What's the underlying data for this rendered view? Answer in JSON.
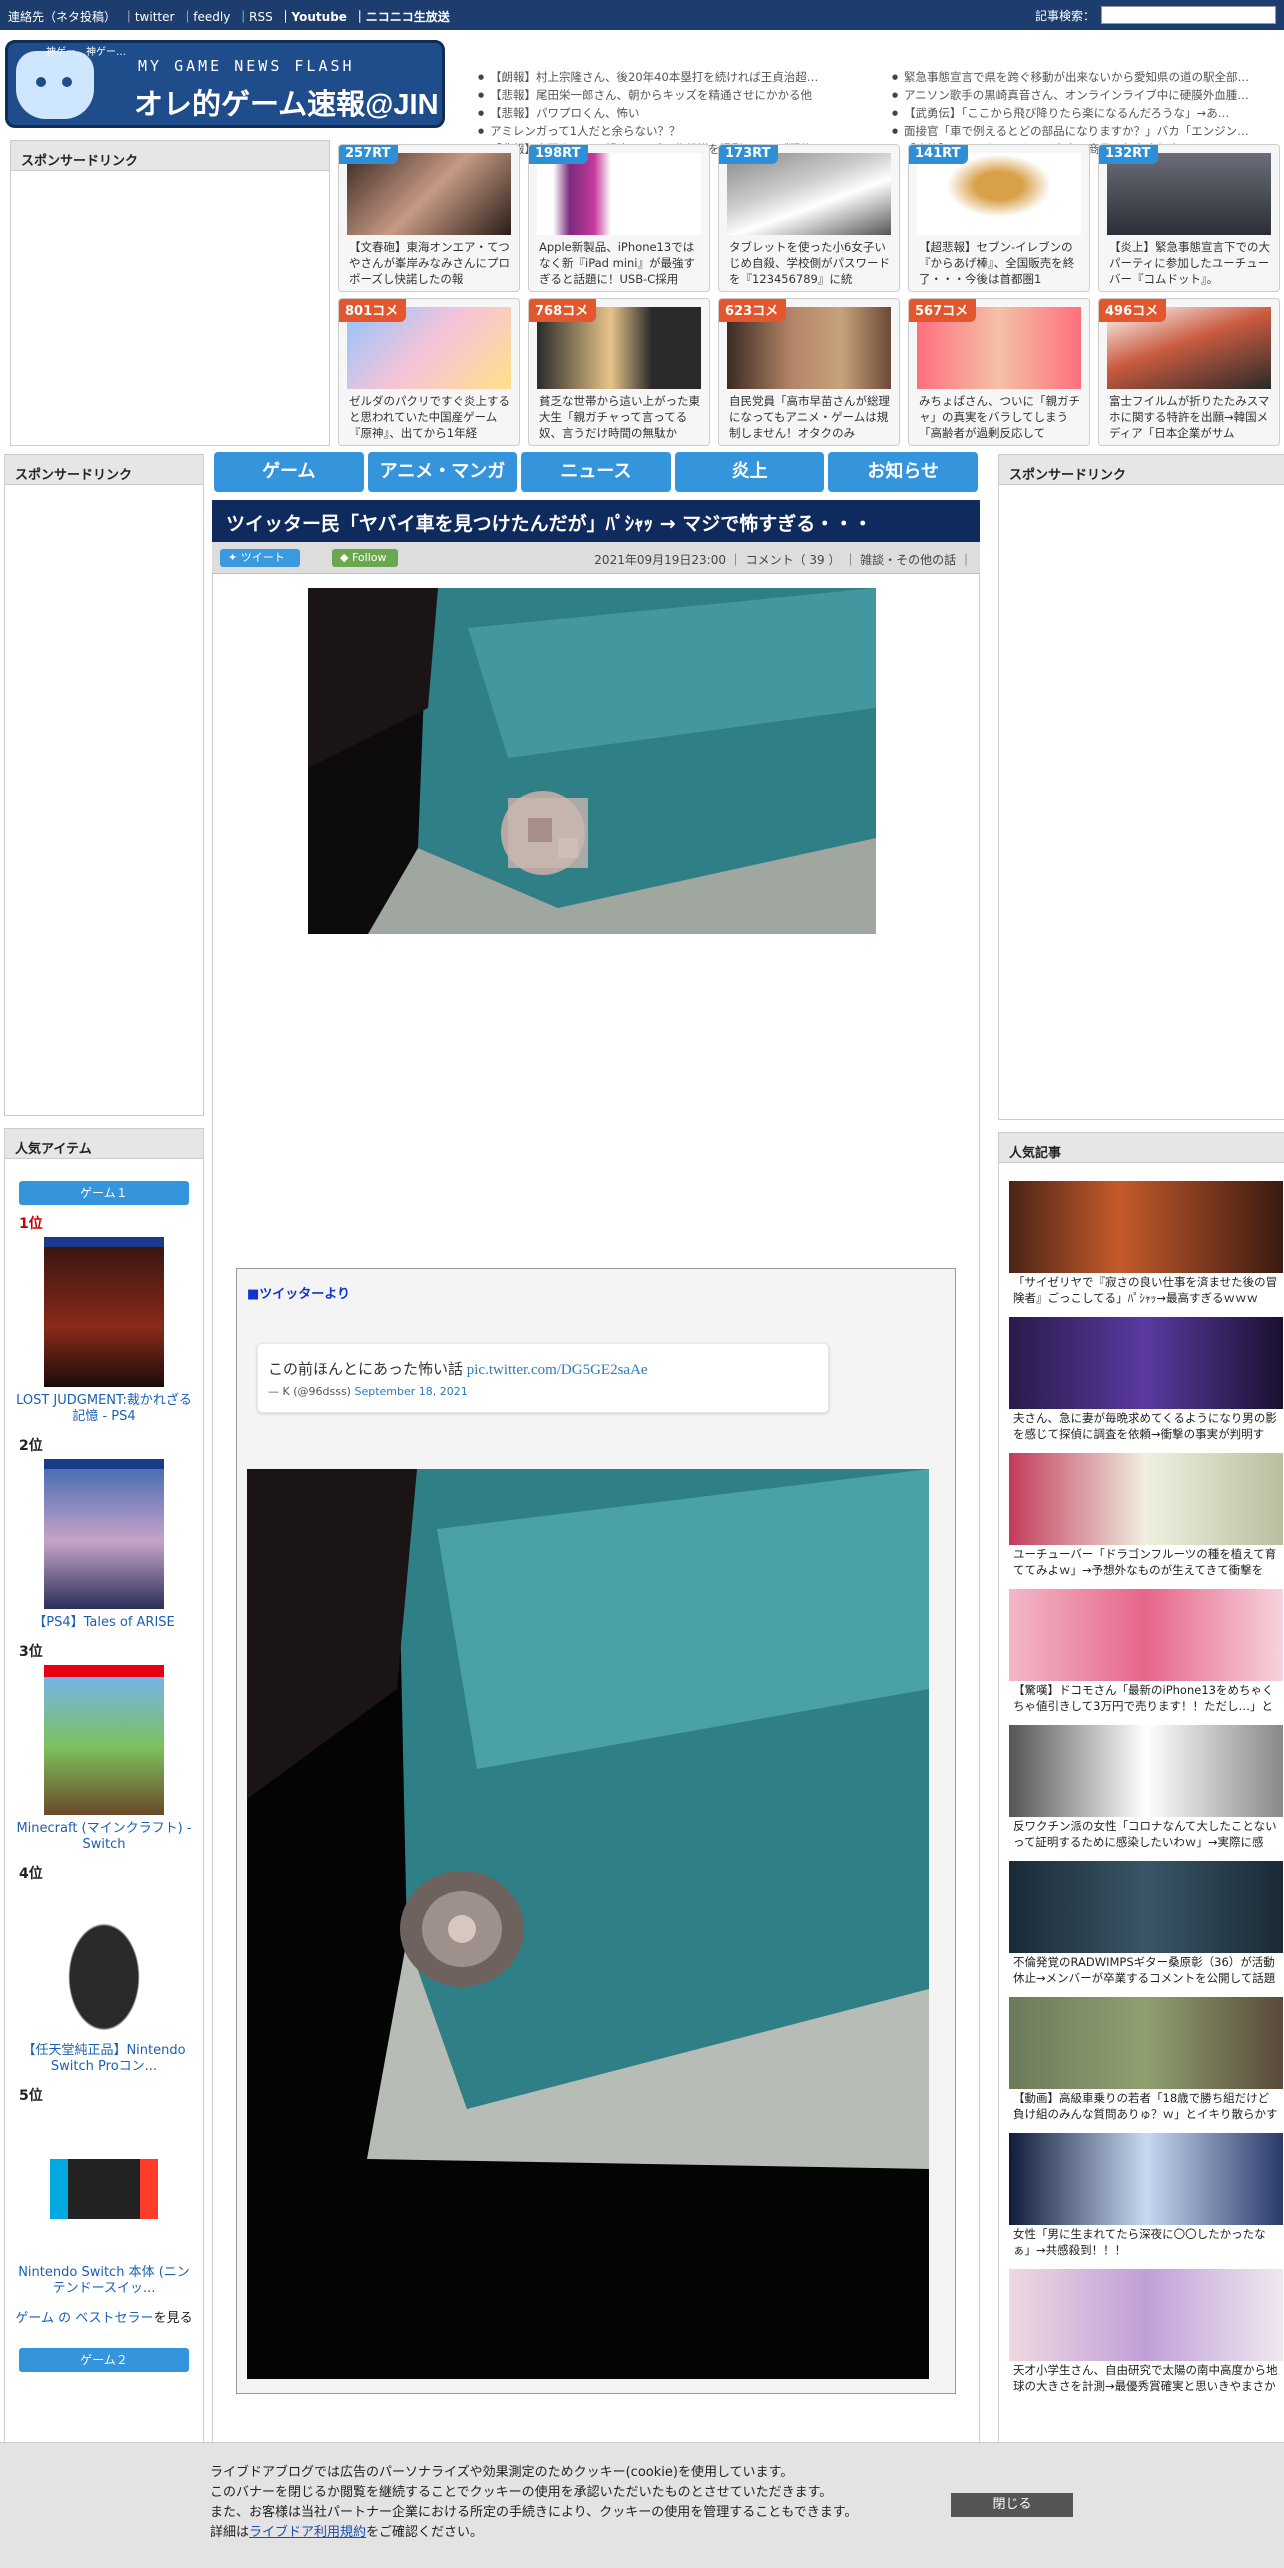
{
  "topbar": {
    "links": [
      "連絡先（ネタ投稿）",
      "｜twitter",
      "｜feedly",
      "｜RSS",
      "｜Youtube",
      "｜ニコニコ生放送"
    ],
    "search_label": "記事検索："
  },
  "logo": {
    "tagline": "MY GAME NEWS FLASH",
    "title": "オレ的ゲーム速報@JIN",
    "chip": "神ゲー…神ゲー…"
  },
  "headlines_left": [
    "【朗報】村上宗隆さん、後20年40本塁打を続ければ王貞治超…",
    "【悲報】尾田栄一郎さん、朝からキッズを精通させにかかる他",
    "【悲報】パワプロくん、怖い",
    "アミレンガって1人だと余らない？？",
    "【悲報】中国人さん、望遠レンズで北朝鮮を撮影しライブ配信し…"
  ],
  "headlines_right": [
    "緊急事態宣言で県を跨ぐ移動が出来ないから愛知県の道の駅全部…",
    "アニソン歌手の黒崎真音さん、オンラインライブ中に硬膜外血腫…",
    "【武勇伝】「ここから飛び降りたら楽になるんだろうな」→あ…",
    "面接官「車で例えるとどの部品になりますか？」バカ「エンジン…",
    "【痛快】ツイッター民さん、自身の商品を無在庫転売しようとし…"
  ],
  "sponsor_label": "スポンサードリンク",
  "cards_row1": [
    {
      "badge": "257RT",
      "text": "【文春砲】東海オンエア・てつやさんが峯岸みなみさんにプロポーズし快諾したの報"
    },
    {
      "badge": "198RT",
      "text": "Apple新製品、iPhone13ではなく新『iPad mini』が最強すぎると話題に！USB-C採用"
    },
    {
      "badge": "173RT",
      "text": "タブレットを使った小6女子いじめ自殺、学校側がパスワードを『123456789』に統"
    },
    {
      "badge": "141RT",
      "text": "【超悲報】セブン-イレブンの『からあげ棒』、全国販売を終了・・・今後は首都圏1"
    },
    {
      "badge": "132RT",
      "text": "【炎上】緊急事態宣言下での大パーティに参加したユーチューバー『コムドット』。"
    }
  ],
  "cards_row2": [
    {
      "badge": "801コメ",
      "text": "ゼルダのパクリですぐ炎上すると思われていた中国産ゲーム『原神』、出てから1年経"
    },
    {
      "badge": "768コメ",
      "text": "貧乏な世帯から這い上がった東大生「親ガチャって言ってる奴、言うだけ時間の無駄か"
    },
    {
      "badge": "623コメ",
      "text": "自民党員「高市早苗さんが総理になってもアニメ・ゲームは規制しません！オタクのみ"
    },
    {
      "badge": "567コメ",
      "text": "みちょぱさん、ついに「親ガチャ」の真実をバラしてしまう「高齢者が過剰反応して"
    },
    {
      "badge": "496コメ",
      "text": "富士フイルムが折りたたみスマホに関する特許を出願→韓国メディア「日本企業がサム"
    }
  ],
  "nav": [
    "ゲーム",
    "アニメ・マンガ",
    "ニュース",
    "炎上",
    "お知らせ"
  ],
  "article": {
    "title": "ツイッター民「ヤバイ車を見つけたんだが」ﾊﾟｼｬｯ → マジで怖すぎる・・・",
    "tweet_btn": "ツイート",
    "follow_btn": "Follow",
    "date": "2021年09月19日23:00",
    "comments": "コメント（ 39 ）",
    "category": "雑談・その他の話",
    "source_label": "■ツイッターより",
    "tweet_text": "この前ほんとにあった怖い話 ",
    "tweet_link": "pic.twitter.com/DG5GE2saAe",
    "tweet_author": "— K (@96dsss) ",
    "tweet_date": "September 18, 2021"
  },
  "popular_items": {
    "label": "人気アイテム",
    "tag1": "ゲーム１",
    "tag2": "ゲーム２",
    "ranks": [
      {
        "pos": "1位",
        "name": "LOST JUDGMENT:裁かれざる記憶 - PS4"
      },
      {
        "pos": "2位",
        "name": "【PS4】Tales of ARISE"
      },
      {
        "pos": "3位",
        "name": "Minecraft (マインクラフト) - Switch"
      },
      {
        "pos": "4位",
        "name": "【任天堂純正品】Nintendo Switch Proコン..."
      },
      {
        "pos": "5位",
        "name": "Nintendo Switch 本体 (ニンテンドースイッ..."
      }
    ],
    "bestseller_link": "ゲーム の ベストセラー",
    "bestseller_suffix": "を見る"
  },
  "popular_articles": {
    "label": "人気記事",
    "items": [
      "「サイゼリヤで『寂さの良い仕事を済ませた後の冒険者』ごっこしてる」ﾊﾟｼｬｯ→最高すぎるｗｗｗ",
      "夫さん、急に妻が毎晩求めてくるようになり男の影を感じて探偵に調査を依頼→衝撃の事実が判明す",
      "ユーチューバー「ドラゴンフルーツの種を植えて育ててみよｗ」→予想外なものが生えてきて衝撃を",
      "【驚嘆】ドコモさん「最新のiPhone13をめちゃくちゃ値引きして3万円で売ります！！ただし…」と",
      "反ワクチン派の女性「コロナなんて大したことないって証明するために感染したいわｗ」→実際に感",
      "不倫発覚のRADWIMPSギター桑原彰（36）が活動休止→メンバーが卒業するコメントを公開して話題",
      "【動画】高級車乗りの若者「18歳で勝ち組だけど負け組のみんな質問ありゅ？ｗ」とイキり散らかす",
      "女性「男に生まれてたら深夜に〇〇したかったなぁ」→共感殺到！！！",
      "天才小学生さん、自由研究で太陽の南中高度から地球の大きさを計測→最優秀賞確実と思いきやまさか"
    ]
  },
  "cookie": {
    "line1": "ライブドアブログでは広告のパーソナライズや効果測定のためクッキー(cookie)を使用しています。",
    "line2": "このバナーを閉じるか閲覧を継続することでクッキーの使用を承認いただいたものとさせていただきます。",
    "line3": "また、お客様は当社パートナー企業における所定の手続きにより、クッキーの使用を管理することもできます。",
    "line4_prefix": "詳細は",
    "line4_link": "ライブドア利用規約",
    "line4_suffix": "をご確認ください。",
    "close": "閉じる"
  }
}
